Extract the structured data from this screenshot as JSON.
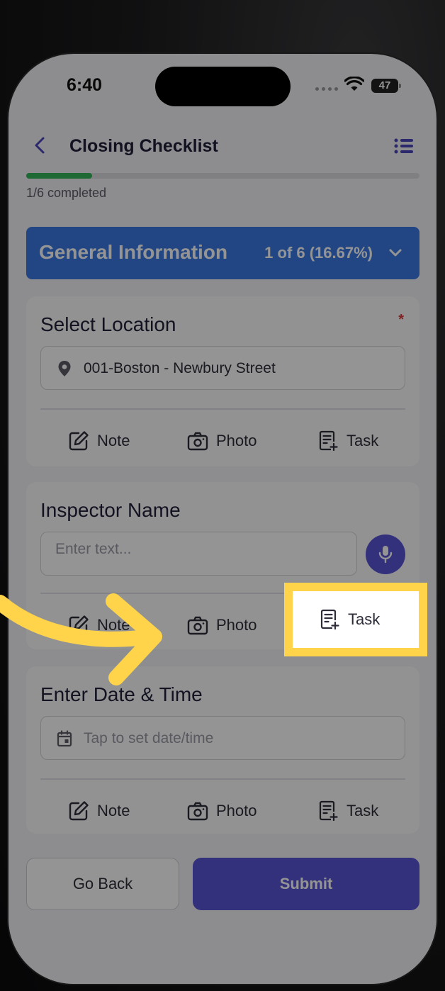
{
  "status_bar": {
    "time": "6:40",
    "battery": "47"
  },
  "header": {
    "title": "Closing Checklist"
  },
  "progress": {
    "label": "1/6 completed",
    "fraction": 0.1667
  },
  "section": {
    "title": "General Information",
    "count": "1 of 6 (16.67%)"
  },
  "cards": {
    "location": {
      "label": "Select Location",
      "required_mark": "*",
      "value": "001-Boston - Newbury Street"
    },
    "inspector": {
      "label": "Inspector Name",
      "placeholder": "Enter text..."
    },
    "datetime": {
      "label": "Enter Date & Time",
      "placeholder": "Tap to set date/time"
    }
  },
  "actions": {
    "note": "Note",
    "photo": "Photo",
    "task": "Task"
  },
  "footer": {
    "back_label": "Go Back",
    "submit_label": "Submit"
  },
  "colors": {
    "accent": "#5b55d6",
    "section_blue": "#3b79e3",
    "progress_green": "#34b55a",
    "highlight_yellow": "#ffd44a",
    "required_red": "#e03a3a"
  },
  "icons": [
    "back-chevron-icon",
    "list-menu-icon",
    "chevron-down-icon",
    "location-pin-icon",
    "note-edit-icon",
    "camera-icon",
    "task-icon",
    "microphone-icon",
    "calendar-icon",
    "pointer-arrow-icon"
  ]
}
